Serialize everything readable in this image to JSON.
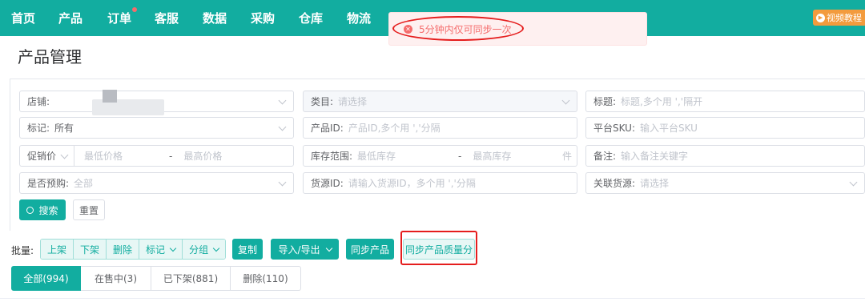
{
  "nav": {
    "items": [
      "首页",
      "产品",
      "订单",
      "客服",
      "数据",
      "采购",
      "仓库",
      "物流"
    ],
    "video_label": "视频教程"
  },
  "toast": {
    "message": "5分钟内仅可同步一次",
    "icon": "error-icon"
  },
  "page_title": "产品管理",
  "filters": {
    "shop_label": "店铺:",
    "category_label": "类目:",
    "category_placeholder": "请选择",
    "title_label": "标题:",
    "title_placeholder": "标题,多个用 ','隔开",
    "tag_label": "标记:",
    "tag_value": "所有",
    "product_id_label": "产品ID:",
    "product_id_placeholder": "产品ID,多个用 ','分隔",
    "platform_sku_label": "平台SKU:",
    "platform_sku_placeholder": "输入平台SKU",
    "price_type": "促销价",
    "price_min_placeholder": "最低价格",
    "price_max_placeholder": "最高价格",
    "stock_label": "库存范围:",
    "stock_min_placeholder": "最低库存",
    "stock_max_placeholder": "最高库存",
    "stock_unit": "件",
    "remark_label": "备注:",
    "remark_placeholder": "输入备注关键字",
    "presale_label": "是否预购:",
    "presale_placeholder": "全部",
    "source_id_label": "货源ID:",
    "source_id_placeholder": "请输入货源ID，多个用 ','分隔",
    "linked_source_label": "关联货源:",
    "linked_source_placeholder": "请选择",
    "range_sep": "-"
  },
  "actions": {
    "search": "搜索",
    "reset": "重置"
  },
  "batch": {
    "label": "批量:",
    "items": [
      "上架",
      "下架",
      "删除",
      "标记",
      "分组"
    ],
    "copy": "复制",
    "import_export": "导入/导出",
    "sync_products": "同步产品",
    "sync_quality": "同步产品质量分"
  },
  "tabs": [
    "全部(994)",
    "在售中(3)",
    "已下架(881)",
    "删除(110)"
  ],
  "colors": {
    "primary": "#12ada0",
    "error": "#f56c6c",
    "highlight_ring": "#e51d1d",
    "video_button": "#f39b3d"
  }
}
